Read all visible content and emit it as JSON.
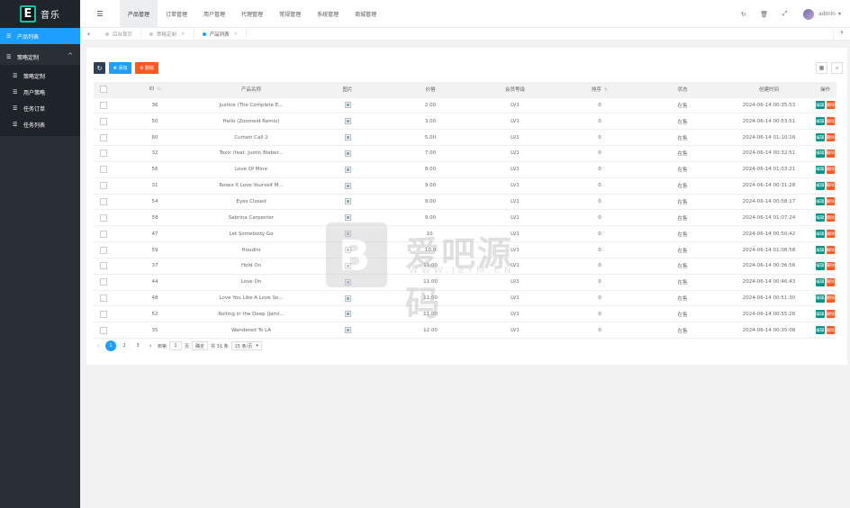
{
  "app": {
    "logo_letter": "E",
    "title": "音乐"
  },
  "sidebar": {
    "items": [
      {
        "label": "产品列表",
        "icon": "list-icon",
        "active": true
      }
    ],
    "group": {
      "label": "策略定制",
      "icon": "list-icon",
      "expanded": true,
      "children": [
        {
          "label": "策略定制",
          "icon": "list-icon"
        },
        {
          "label": "用户策略",
          "icon": "list-icon"
        },
        {
          "label": "任务订单",
          "icon": "list-icon"
        },
        {
          "label": "任务列表",
          "icon": "list-icon"
        }
      ]
    }
  },
  "topbar": {
    "menu_icon": "menu-icon",
    "tabs": [
      {
        "label": "产品管理",
        "active": true
      },
      {
        "label": "订单管理"
      },
      {
        "label": "用户管理"
      },
      {
        "label": "代理管理"
      },
      {
        "label": "常规管理"
      },
      {
        "label": "系统管理"
      },
      {
        "label": "商城管理"
      }
    ],
    "user": "admin"
  },
  "page_tabs": [
    {
      "label": "后台首页",
      "closable": false
    },
    {
      "label": "策略定制",
      "closable": true
    },
    {
      "label": "产品列表",
      "closable": true,
      "active": true
    }
  ],
  "toolbar": {
    "add_label": "✚ 添加",
    "delete_label": "⊗ 删除"
  },
  "table": {
    "columns": [
      "ID",
      "产品名称",
      "图片",
      "价格",
      "会员等级",
      "排序",
      "状态",
      "创建时间",
      "操作"
    ],
    "rows": [
      [
        "36",
        "Justice (The Complete E...",
        "2.00",
        "LV1",
        "0",
        "在售",
        "2024-06-14 00:35:53"
      ],
      [
        "50",
        "Hello (Zoomeid Remix)",
        "3.00",
        "LV1",
        "0",
        "在售",
        "2024-06-14 00:53:51"
      ],
      [
        "60",
        "Curtain Call 2",
        "5.00",
        "LV1",
        "0",
        "在售",
        "2024-06-14 01:10:16"
      ],
      [
        "32",
        "Toxic (feat. Justin Bieber...",
        "7.00",
        "LV1",
        "0",
        "在售",
        "2024-06-14 00:32:51"
      ],
      [
        "56",
        "Love Of Mine",
        "8.00",
        "LV1",
        "0",
        "在售",
        "2024-06-14 01:03:21"
      ],
      [
        "31",
        "Roses X Love Yourself M...",
        "9.00",
        "LV1",
        "0",
        "在售",
        "2024-06-14 00:31:28"
      ],
      [
        "54",
        "Eyes Closed",
        "9.00",
        "LV1",
        "0",
        "在售",
        "2024-06-14 00:58:17"
      ],
      [
        "58",
        "Sabrina Carpenter",
        "9.00",
        "LV1",
        "0",
        "在售",
        "2024-06-14 01:07:24"
      ],
      [
        "47",
        "Let Somebody Go",
        "10.",
        "LV1",
        "0",
        "在售",
        "2024-06-14 00:50:42"
      ],
      [
        "59",
        "Houdini",
        "10.0",
        "LV1",
        "0",
        "在售",
        "2024-06-14 01:08:58"
      ],
      [
        "37",
        "Hold On",
        "11.00",
        "LV1",
        "0",
        "在售",
        "2024-06-14 00:36:56"
      ],
      [
        "44",
        "Love On",
        "11.00",
        "LV1",
        "0",
        "在售",
        "2024-06-14 00:46:43"
      ],
      [
        "48",
        "Love You Like A Love So...",
        "11.00",
        "LV1",
        "0",
        "在售",
        "2024-06-14 00:51:30"
      ],
      [
        "52",
        "Rolling in the Deep (Jami...",
        "11.00",
        "LV1",
        "0",
        "在售",
        "2024-06-14 00:55:26"
      ],
      [
        "35",
        "Wandered To LA",
        "12.00",
        "LV1",
        "0",
        "在售",
        "2024-06-14 00:35:08"
      ]
    ],
    "edit_label": "编辑",
    "delete_label": "删除"
  },
  "pager": {
    "pages": [
      "1",
      "2",
      "3"
    ],
    "current": "1",
    "goto_label": "到第",
    "goto_value": "1",
    "page_unit": "页",
    "confirm_label": "确定",
    "total_label": "共 31 条",
    "page_size": "15 条/页"
  },
  "watermark": {
    "logo": "B",
    "title": "爱吧源码",
    "url": "WWW.IBYM.CN"
  }
}
